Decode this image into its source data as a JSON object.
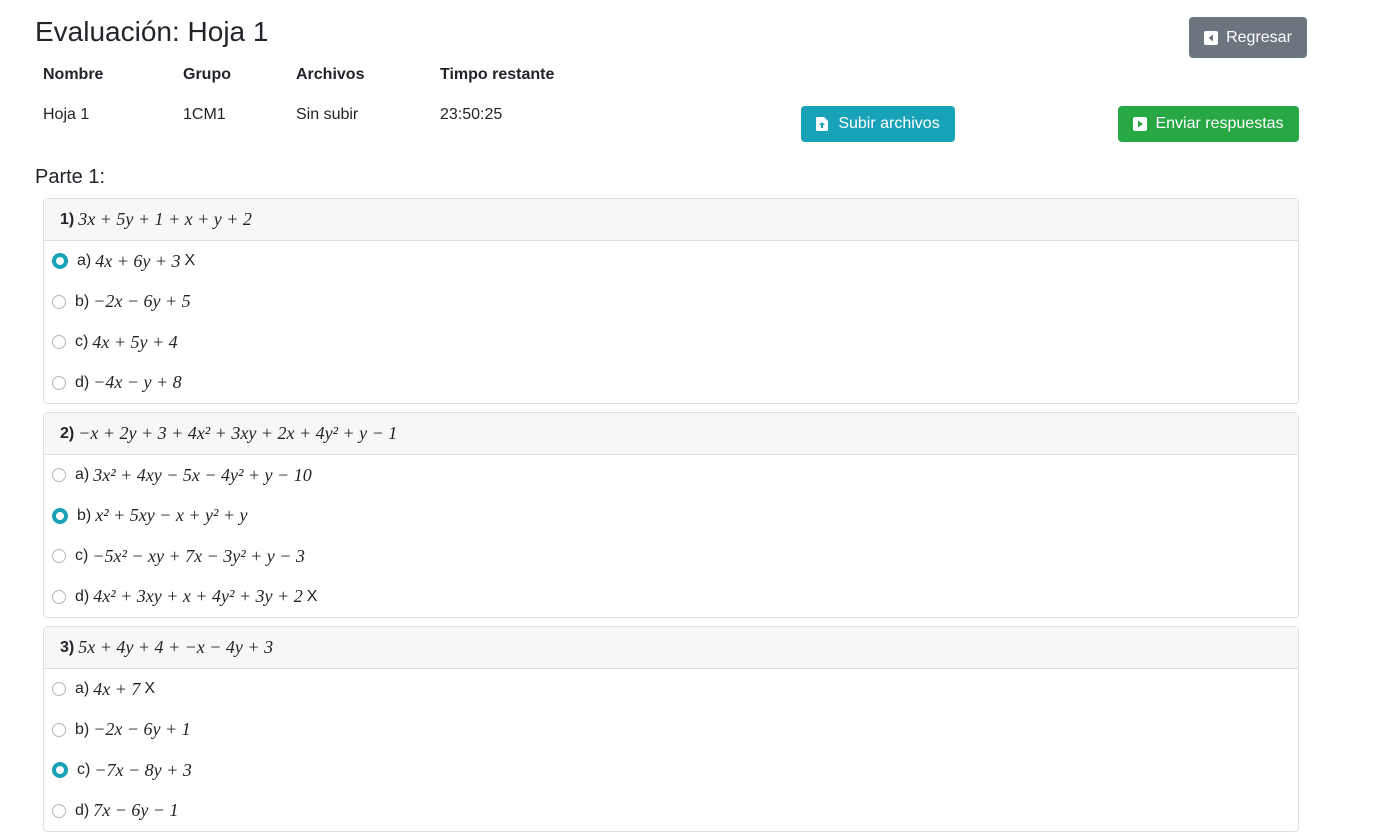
{
  "header": {
    "title": "Evaluación: Hoja 1",
    "back_label": "Regresar"
  },
  "info": {
    "columns": [
      "Nombre",
      "Grupo",
      "Archivos",
      "Timpo restante"
    ],
    "values": [
      "Hoja 1",
      "1CM1",
      "Sin subir",
      "23:50:25"
    ]
  },
  "actions": {
    "upload_label": "Subir archivos",
    "send_label": "Enviar respuestas"
  },
  "colors": {
    "back": "#6c757d",
    "upload": "#17a2b8",
    "send": "#28a745",
    "radio_selected": "#17a2b8"
  },
  "part": {
    "title": "Parte 1:"
  },
  "questions": [
    {
      "number": "1)",
      "text": "3x + 5y + 1 + x + y + 2",
      "options": [
        {
          "letter": "a)",
          "text": "4x + 6y + 3",
          "mark": "X",
          "selected": true
        },
        {
          "letter": "b)",
          "text": "−2x − 6y + 5",
          "mark": "",
          "selected": false
        },
        {
          "letter": "c)",
          "text": "4x + 5y + 4",
          "mark": "",
          "selected": false
        },
        {
          "letter": "d)",
          "text": "−4x − y + 8",
          "mark": "",
          "selected": false
        }
      ]
    },
    {
      "number": "2)",
      "text": "−x + 2y + 3 + 4x² + 3xy + 2x + 4y² + y − 1",
      "options": [
        {
          "letter": "a)",
          "text": "3x² + 4xy − 5x − 4y² + y − 10",
          "mark": "",
          "selected": false
        },
        {
          "letter": "b)",
          "text": "x² + 5xy − x + y² + y",
          "mark": "",
          "selected": true
        },
        {
          "letter": "c)",
          "text": "−5x² − xy + 7x − 3y² + y − 3",
          "mark": "",
          "selected": false
        },
        {
          "letter": "d)",
          "text": "4x² + 3xy + x + 4y² + 3y + 2",
          "mark": "X",
          "selected": false
        }
      ]
    },
    {
      "number": "3)",
      "text": "5x + 4y + 4 + −x − 4y + 3",
      "options": [
        {
          "letter": "a)",
          "text": "4x + 7",
          "mark": "X",
          "selected": false
        },
        {
          "letter": "b)",
          "text": "−2x − 6y + 1",
          "mark": "",
          "selected": false
        },
        {
          "letter": "c)",
          "text": "−7x − 8y + 3",
          "mark": "",
          "selected": true
        },
        {
          "letter": "d)",
          "text": "7x − 6y − 1",
          "mark": "",
          "selected": false
        }
      ]
    }
  ]
}
